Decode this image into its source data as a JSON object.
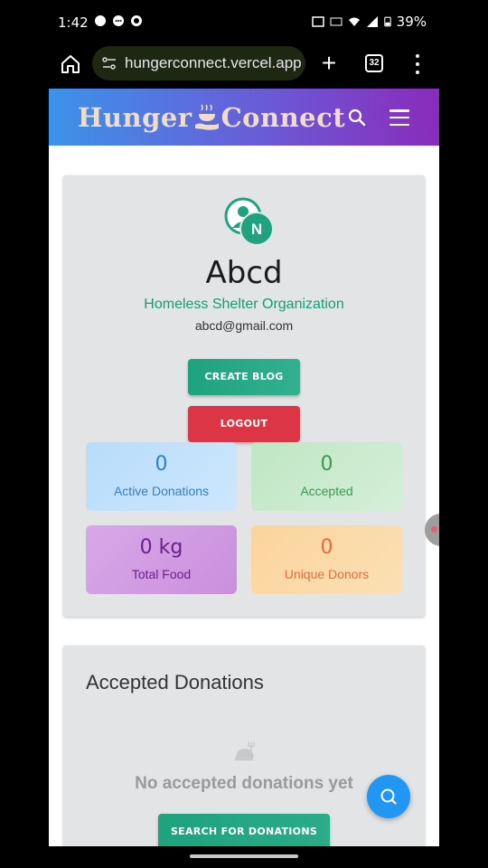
{
  "status_bar": {
    "time": "1:42",
    "battery": "39%"
  },
  "browser": {
    "url": "hungerconnect.vercel.app",
    "tab_count": "32"
  },
  "navbar": {
    "brand_left": "Hunger",
    "brand_right": "Connect"
  },
  "profile": {
    "avatar_initial": "N",
    "name": "Abcd",
    "type": "Homeless Shelter Organization",
    "email": "abcd@gmail.com",
    "create_blog_label": "CREATE BLOG",
    "logout_label": "LOGOUT"
  },
  "stats": {
    "active": {
      "value": "0",
      "label": "Active Donations"
    },
    "accepted": {
      "value": "0",
      "label": "Accepted"
    },
    "food": {
      "value": "0 kg",
      "label": "Total Food"
    },
    "donors": {
      "value": "0",
      "label": "Unique Donors"
    }
  },
  "accepted_section": {
    "title": "Accepted Donations",
    "empty_text": "No accepted donations yet",
    "search_label": "SEARCH FOR DONATIONS"
  },
  "colors": {
    "accent_green": "#1ea37e",
    "logout_red": "#dc3545",
    "fab_blue": "#2196f3"
  }
}
